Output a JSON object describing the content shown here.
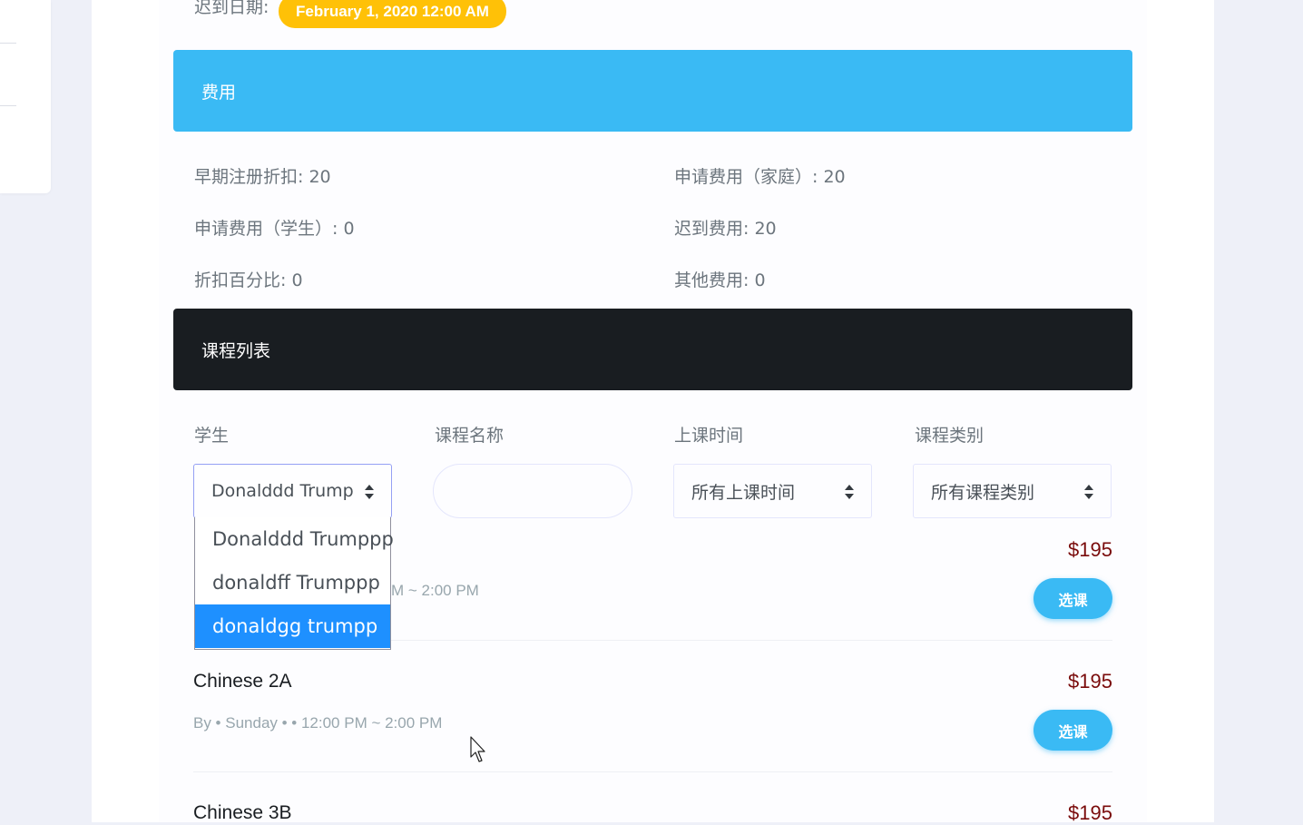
{
  "registration": {
    "late_date_label": "迟到日期:",
    "late_date_value": "February 1, 2020 12:00 AM"
  },
  "fees": {
    "header": "费用",
    "early_discount": "早期注册折扣: 20",
    "family_fee": "申请费用（家庭）: 20",
    "student_fee": "申请费用（学生）: 0",
    "late_fee": "迟到费用: 20",
    "discount_percent": "折扣百分比: 0",
    "other_fee": "其他费用: 0"
  },
  "courses": {
    "header": "课程列表",
    "filters": {
      "student_label": "学生",
      "course_name_label": "课程名称",
      "time_label": "上课时间",
      "category_label": "课程类别",
      "student_value": "Donalddd Trump",
      "time_value": "所有上课时间",
      "category_value": "所有课程类别",
      "student_options": [
        {
          "label": "Donalddd Trumppp",
          "highlighted": false
        },
        {
          "label": "donaldff Trumppp",
          "highlighted": false
        },
        {
          "label": "donaldgg trumpp",
          "highlighted": true
        }
      ]
    },
    "items": [
      {
        "name": "",
        "meta": "M ~ 2:00 PM",
        "price": "$195",
        "button": "选课"
      },
      {
        "name": "Chinese 2A",
        "meta": "By  •  Sunday  •   •  12:00 PM ~ 2:00 PM",
        "price": "$195",
        "button": "选课"
      },
      {
        "name": "Chinese 3B",
        "meta": "",
        "price": "$195",
        "button": ""
      }
    ]
  },
  "colors": {
    "fees_header": "#3abaf4",
    "courses_header": "#191d21",
    "badge": "#ffc107",
    "price": "#7a0b0b",
    "dropdown_highlight": "#1e90ff"
  }
}
